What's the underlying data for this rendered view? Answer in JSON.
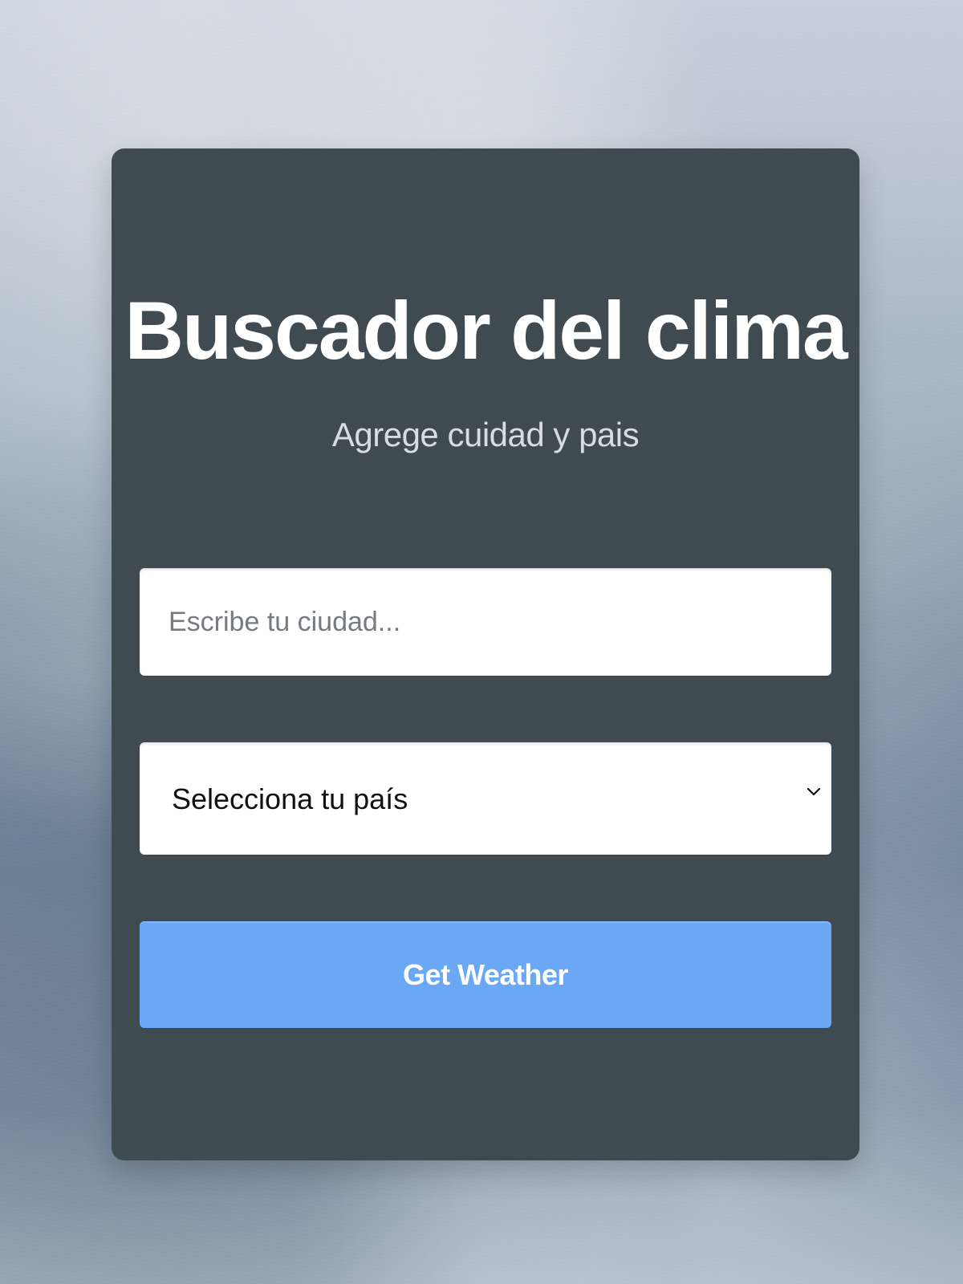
{
  "page": {
    "title": "Buscador del clima",
    "subtitle": "Agrege cuidad y pais"
  },
  "form": {
    "city_input": {
      "value": "",
      "placeholder": "Escribe tu ciudad..."
    },
    "country_select": {
      "selected": "Selecciona tu país",
      "icon": "chevron-down-icon"
    },
    "submit_button": {
      "label": "Get Weather"
    }
  },
  "colors": {
    "card": "#3f4a51",
    "button": "#6aa7f5",
    "title": "#ffffff",
    "subtitle": "#d8dde2"
  }
}
